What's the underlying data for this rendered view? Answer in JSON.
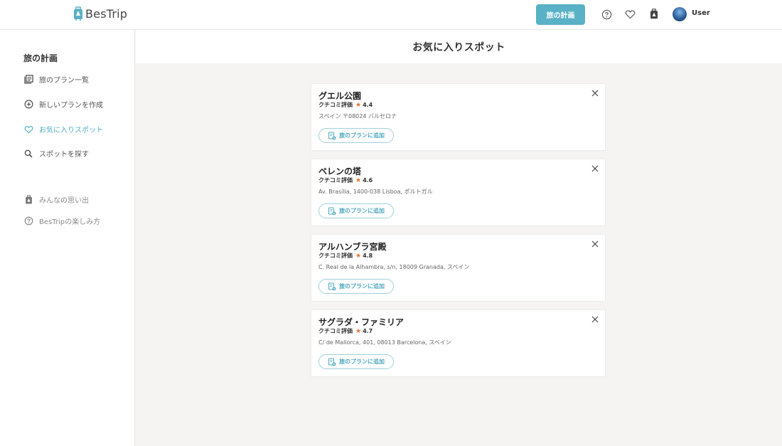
{
  "header": {
    "logo_text": "BesTrip",
    "plan_button": "旅の計画",
    "icons": [
      "help-icon",
      "heart-icon",
      "memories-icon"
    ],
    "user_name": "User"
  },
  "sidebar": {
    "heading": "旅の計画",
    "items": [
      {
        "label": "旅のプラン一覧",
        "icon": "plan-list-icon"
      },
      {
        "label": "新しいプランを作成",
        "icon": "add-circle-icon"
      },
      {
        "label": "お気に入りスポット",
        "icon": "heart-icon",
        "active": true
      },
      {
        "label": "スポットを探す",
        "icon": "search-icon"
      }
    ],
    "secondary_items": [
      {
        "label": "みんなの思い出",
        "icon": "memories-icon"
      },
      {
        "label": "BesTripの楽しみ方",
        "icon": "help-icon"
      }
    ]
  },
  "main": {
    "title": "お気に入りスポット",
    "spots": [
      {
        "name": "グエル公園",
        "rating_label": "クチコミ評価",
        "rating": "4.4",
        "address": "スペイン 〒08024 バルセロナ",
        "add_label": "旅のプランに追加"
      },
      {
        "name": "ベレンの塔",
        "rating_label": "クチコミ評価",
        "rating": "4.6",
        "address": "Av. Brasília, 1400-038 Lisboa, ポルトガル",
        "add_label": "旅のプランに追加"
      },
      {
        "name": "アルハンブラ宮殿",
        "rating_label": "クチコミ評価",
        "rating": "4.8",
        "address": "C. Real de la Alhambra, s/n, 18009 Granada, スペイン",
        "add_label": "旅のプランに追加"
      },
      {
        "name": "サグラダ・ファミリア",
        "rating_label": "クチコミ評価",
        "rating": "4.7",
        "address": "C/ de Mallorca, 401, 08013 Barcelona, スペイン",
        "add_label": "旅のプランに追加"
      }
    ]
  },
  "colors": {
    "accent": "#59b1c6",
    "active_text": "#4fb0c6",
    "star": "#e8742a"
  }
}
